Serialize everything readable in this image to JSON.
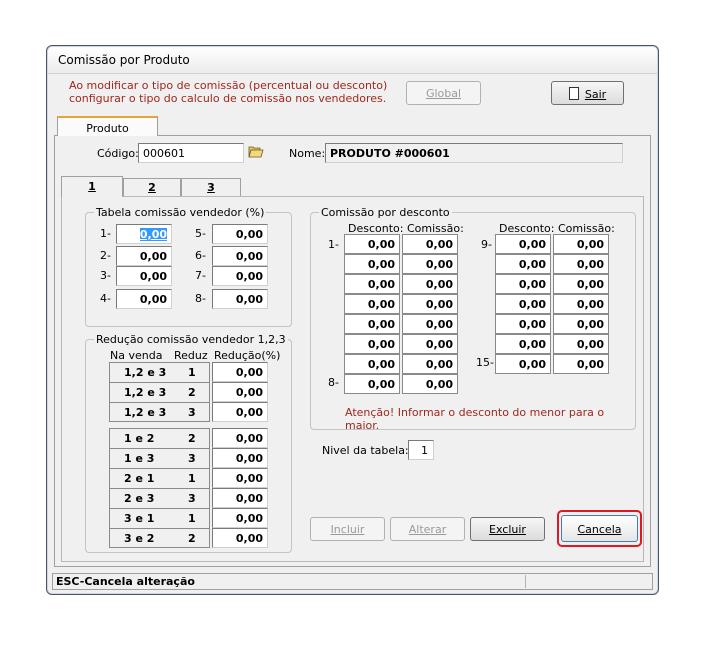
{
  "window": {
    "title": "Comissão por Produto"
  },
  "header": {
    "notice_line1": "Ao modificar o tipo de comissão (percentual ou desconto)",
    "notice_line2": "configurar o tipo do calculo de comissão nos vendedores.",
    "global_label": "Global",
    "sair_label": "Sair"
  },
  "main_tab": {
    "label": "Produto"
  },
  "product": {
    "codigo_label": "Código:",
    "codigo_value": "000601",
    "nome_label": "Nome:",
    "nome_value": "PRODUTO #000601"
  },
  "subtabs": [
    "1",
    "2",
    "3"
  ],
  "tabela": {
    "title": "Tabela comissão vendedor (%)",
    "left": [
      {
        "label": "1-",
        "value": "0,00"
      },
      {
        "label": "2-",
        "value": "0,00"
      },
      {
        "label": "3-",
        "value": "0,00"
      },
      {
        "label": "4-",
        "value": "0,00"
      }
    ],
    "right": [
      {
        "label": "5-",
        "value": "0,00"
      },
      {
        "label": "6-",
        "value": "0,00"
      },
      {
        "label": "7-",
        "value": "0,00"
      },
      {
        "label": "8-",
        "value": "0,00"
      }
    ]
  },
  "reducao": {
    "title": "Redução comissão vendedor 1,2,3",
    "col_venda": "Na venda",
    "col_reduz": "Reduz",
    "col_reducao": "Redução(%)",
    "group1": [
      {
        "venda": "1,2 e 3",
        "reduz": "1",
        "valor": "0,00"
      },
      {
        "venda": "1,2 e 3",
        "reduz": "2",
        "valor": "0,00"
      },
      {
        "venda": "1,2 e 3",
        "reduz": "3",
        "valor": "0,00"
      }
    ],
    "group2": [
      {
        "venda": "1 e 2",
        "reduz": "2",
        "valor": "0,00"
      },
      {
        "venda": "1 e 3",
        "reduz": "3",
        "valor": "0,00"
      },
      {
        "venda": "2 e 1",
        "reduz": "1",
        "valor": "0,00"
      },
      {
        "venda": "2 e 3",
        "reduz": "3",
        "valor": "0,00"
      },
      {
        "venda": "3 e 1",
        "reduz": "1",
        "valor": "0,00"
      },
      {
        "venda": "3 e 2",
        "reduz": "2",
        "valor": "0,00"
      }
    ]
  },
  "desconto": {
    "title": "Comissão por desconto",
    "col_desconto": "Desconto:",
    "col_comissao": "Comissão:",
    "left_first_label": "1-",
    "left_last_label": "8-",
    "right_first_label": "9-",
    "right_last_label": "15-",
    "left_rows": [
      {
        "desconto": "0,00",
        "comissao": "0,00"
      },
      {
        "desconto": "0,00",
        "comissao": "0,00"
      },
      {
        "desconto": "0,00",
        "comissao": "0,00"
      },
      {
        "desconto": "0,00",
        "comissao": "0,00"
      },
      {
        "desconto": "0,00",
        "comissao": "0,00"
      },
      {
        "desconto": "0,00",
        "comissao": "0,00"
      },
      {
        "desconto": "0,00",
        "comissao": "0,00"
      },
      {
        "desconto": "0,00",
        "comissao": "0,00"
      }
    ],
    "right_rows": [
      {
        "desconto": "0,00",
        "comissao": "0,00"
      },
      {
        "desconto": "0,00",
        "comissao": "0,00"
      },
      {
        "desconto": "0,00",
        "comissao": "0,00"
      },
      {
        "desconto": "0,00",
        "comissao": "0,00"
      },
      {
        "desconto": "0,00",
        "comissao": "0,00"
      },
      {
        "desconto": "0,00",
        "comissao": "0,00"
      },
      {
        "desconto": "0,00",
        "comissao": "0,00"
      }
    ],
    "warning": "Atenção!  Informar o desconto do menor para o maior."
  },
  "nivel": {
    "label": "Nivel da tabela:",
    "value": "1"
  },
  "actions": {
    "incluir": "Incluir",
    "alterar": "Alterar",
    "excluir": "Excluir",
    "cancela": "Cancela"
  },
  "status": {
    "text": "ESC-Cancela alteração"
  },
  "colors": {
    "warning_text": "#a0281e",
    "highlight_border": "#e0191e"
  }
}
